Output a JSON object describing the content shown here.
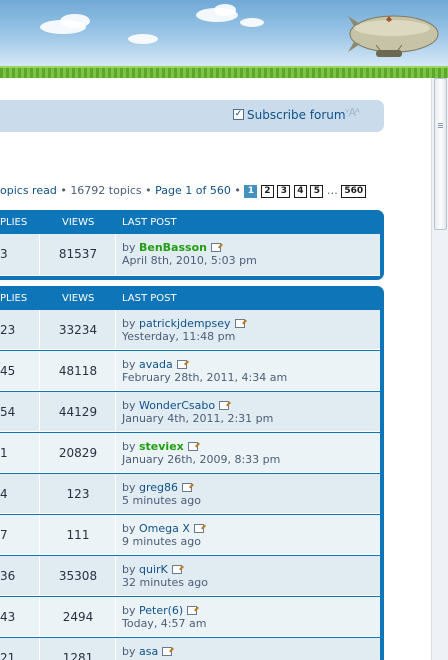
{
  "subscribe": {
    "label": "Subscribe forum",
    "checked": true,
    "font_size_control": "ᵛAᴬ"
  },
  "stats": {
    "topics_read_link": "opics read",
    "sep1": " • ",
    "topics_count": "16792 topics",
    "sep2": " • ",
    "page_info": "Page 1 of 560",
    "sep3": " • ",
    "pages": [
      "1",
      "2",
      "3",
      "4",
      "5"
    ],
    "ellipsis": "…",
    "last_page": "560"
  },
  "announcements": {
    "headers": {
      "replies": "PLIES",
      "views": "VIEWS",
      "last_post": "LAST POST"
    },
    "rows": [
      {
        "replies": "3",
        "views": "81537",
        "by_prefix": "by",
        "author": "BenBasson",
        "date": "April 8th, 2010, 5:03 pm"
      }
    ]
  },
  "topics": {
    "headers": {
      "replies": "PLIES",
      "views": "VIEWS",
      "last_post": "LAST POST"
    },
    "rows": [
      {
        "replies": "23",
        "views": "33234",
        "by_prefix": "by",
        "author": "patrickjdempsey",
        "date": "Yesterday, 11:48 pm"
      },
      {
        "replies": "45",
        "views": "48118",
        "by_prefix": "by",
        "author": "avada",
        "date": "February 28th, 2011, 4:34 am"
      },
      {
        "replies": "54",
        "views": "44129",
        "by_prefix": "by",
        "author": "WonderCsabo",
        "date": "January 4th, 2011, 2:31 pm"
      },
      {
        "replies": "1",
        "views": "20829",
        "by_prefix": "by",
        "author": "steviex",
        "date": "January 26th, 2009, 8:33 pm"
      },
      {
        "replies": "4",
        "views": "123",
        "by_prefix": "by",
        "author": "greg86",
        "date": "5 minutes ago"
      },
      {
        "replies": "7",
        "views": "111",
        "by_prefix": "by",
        "author": "Omega X",
        "date": "9 minutes ago"
      },
      {
        "replies": "36",
        "views": "35308",
        "by_prefix": "by",
        "author": "quirK",
        "date": "32 minutes ago"
      },
      {
        "replies": "43",
        "views": "2494",
        "by_prefix": "by",
        "author": "Peter(6)",
        "date": "Today, 4:57 am"
      },
      {
        "replies": "21",
        "views": "1281",
        "by_prefix": "by",
        "author": "asa",
        "date": ""
      }
    ]
  }
}
